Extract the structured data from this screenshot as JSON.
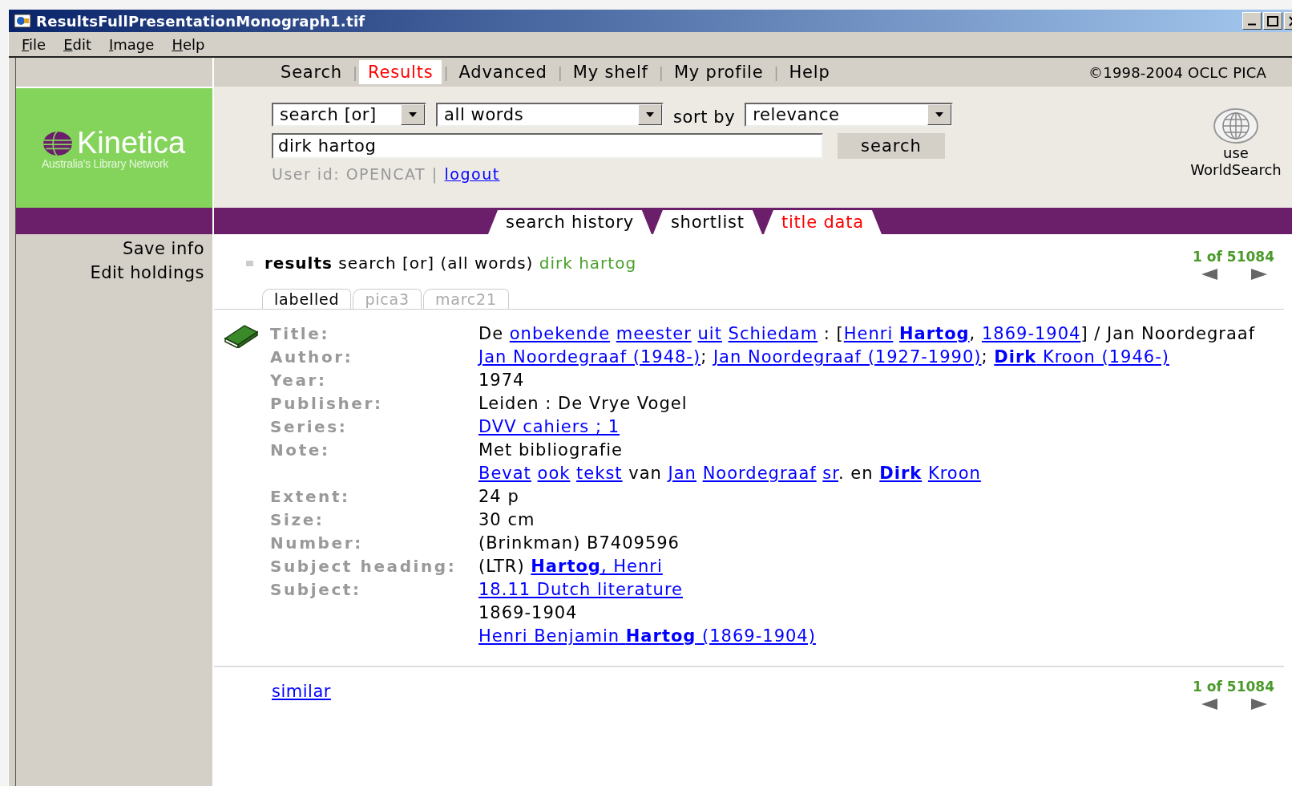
{
  "window": {
    "title": "ResultsFullPresentationMonograph1.tif"
  },
  "menu": [
    {
      "label": "File"
    },
    {
      "label": "Edit"
    },
    {
      "label": "Image"
    },
    {
      "label": "Help"
    }
  ],
  "nav": {
    "separator": "|",
    "tabs": [
      {
        "label": "Search",
        "selected": false
      },
      {
        "label": "Results",
        "selected": true
      },
      {
        "label": "Advanced",
        "selected": false
      },
      {
        "label": "My shelf",
        "selected": false
      },
      {
        "label": "My profile",
        "selected": false
      },
      {
        "label": "Help",
        "selected": false
      }
    ],
    "copyright": "©1998-2004 OCLC PICA"
  },
  "logo": {
    "name": "Kinetica",
    "tagline": "Australia's Library Network"
  },
  "search": {
    "mode": "search [or]",
    "words": "all words",
    "sort_label": "sort by",
    "sort": "relevance",
    "query": "dirk hartog",
    "button": "search",
    "user": "User id: OPENCAT |",
    "logout": "logout",
    "worldsearch": "use WorldSearch"
  },
  "subtabs": [
    {
      "label": "search history",
      "selected": false
    },
    {
      "label": "shortlist",
      "selected": false
    },
    {
      "label": "title data",
      "selected": true
    }
  ],
  "sidebar": {
    "items": [
      "Save info",
      "Edit holdings"
    ]
  },
  "results": {
    "heading": "**results** search [or] (all words)",
    "query": "dirk hartog",
    "count": "1 of 51084"
  },
  "formats": [
    {
      "label": "labelled",
      "selected": true
    },
    {
      "label": "pica3",
      "selected": false
    },
    {
      "label": "marc21",
      "selected": false
    }
  ],
  "record": {
    "fields": [
      {
        "label": "Title:",
        "lines": [
          [
            {
              "kind": "text",
              "text": "De "
            },
            {
              "kind": "link",
              "text": "onbekende",
              "space": true
            },
            {
              "kind": "link",
              "text": "meester",
              "space": true
            },
            {
              "kind": "link",
              "text": "uit",
              "space": true
            },
            {
              "kind": "link",
              "text": "Schiedam"
            },
            {
              "kind": "text",
              "text": " : ["
            },
            {
              "kind": "link",
              "text": "Henri",
              "space": true
            },
            {
              "kind": "link",
              "text": "Hartog",
              "bold": true
            },
            {
              "kind": "text",
              "text": ", "
            },
            {
              "kind": "link",
              "text": "1869-1904"
            },
            {
              "kind": "text",
              "text": "] / Jan Noordegraaf"
            }
          ]
        ]
      },
      {
        "label": "Author:",
        "lines": [
          [
            {
              "kind": "link",
              "text": "Jan Noordegraaf (1948-)"
            },
            {
              "kind": "text",
              "text": "; "
            },
            {
              "kind": "link",
              "text": "Jan Noordegraaf (1927-1990)"
            },
            {
              "kind": "text",
              "text": "; "
            },
            {
              "kind": "link",
              "text": "**Dirk** Kroon (1946-)"
            }
          ]
        ]
      },
      {
        "label": "Year:",
        "lines": [
          [
            {
              "kind": "text",
              "text": "1974"
            }
          ]
        ]
      },
      {
        "label": "Publisher:",
        "lines": [
          [
            {
              "kind": "text",
              "text": "Leiden : De Vrye Vogel"
            }
          ]
        ]
      },
      {
        "label": "Series:",
        "lines": [
          [
            {
              "kind": "link",
              "text": "DVV cahiers ; 1"
            }
          ]
        ]
      },
      {
        "label": "Note:",
        "lines": [
          [
            {
              "kind": "text",
              "text": "Met bibliografie"
            }
          ],
          [
            {
              "kind": "link",
              "text": "Bevat",
              "space": true
            },
            {
              "kind": "link",
              "text": "ook",
              "space": true
            },
            {
              "kind": "link",
              "text": "tekst"
            },
            {
              "kind": "text",
              "text": " van "
            },
            {
              "kind": "link",
              "text": "Jan",
              "space": true
            },
            {
              "kind": "link",
              "text": "Noordegraaf",
              "space": true
            },
            {
              "kind": "link",
              "text": "sr"
            },
            {
              "kind": "text",
              "text": ". en "
            },
            {
              "kind": "link",
              "text": "Dirk",
              "bold": true,
              "space": true
            },
            {
              "kind": "link",
              "text": "Kroon"
            }
          ]
        ]
      },
      {
        "label": "Extent:",
        "lines": [
          [
            {
              "kind": "text",
              "text": "24 p"
            }
          ]
        ]
      },
      {
        "label": "Size:",
        "lines": [
          [
            {
              "kind": "text",
              "text": "30 cm"
            }
          ]
        ]
      },
      {
        "label": "Number:",
        "lines": [
          [
            {
              "kind": "text",
              "text": "(Brinkman) B7409596"
            }
          ]
        ]
      },
      {
        "label": "Subject heading:",
        "lines": [
          [
            {
              "kind": "text",
              "text": "(LTR) "
            },
            {
              "kind": "link",
              "text": "**Hartog**, Henri"
            }
          ]
        ]
      },
      {
        "label": "Subject:",
        "lines": [
          [
            {
              "kind": "link",
              "text": "18.11 Dutch literature"
            }
          ],
          [
            {
              "kind": "text",
              "text": "1869-1904"
            }
          ],
          [
            {
              "kind": "link",
              "text": "Henri Benjamin **Hartog** (1869-1904)"
            }
          ]
        ]
      }
    ]
  },
  "footer": {
    "similar": "similar",
    "count": "1 of 51084"
  }
}
